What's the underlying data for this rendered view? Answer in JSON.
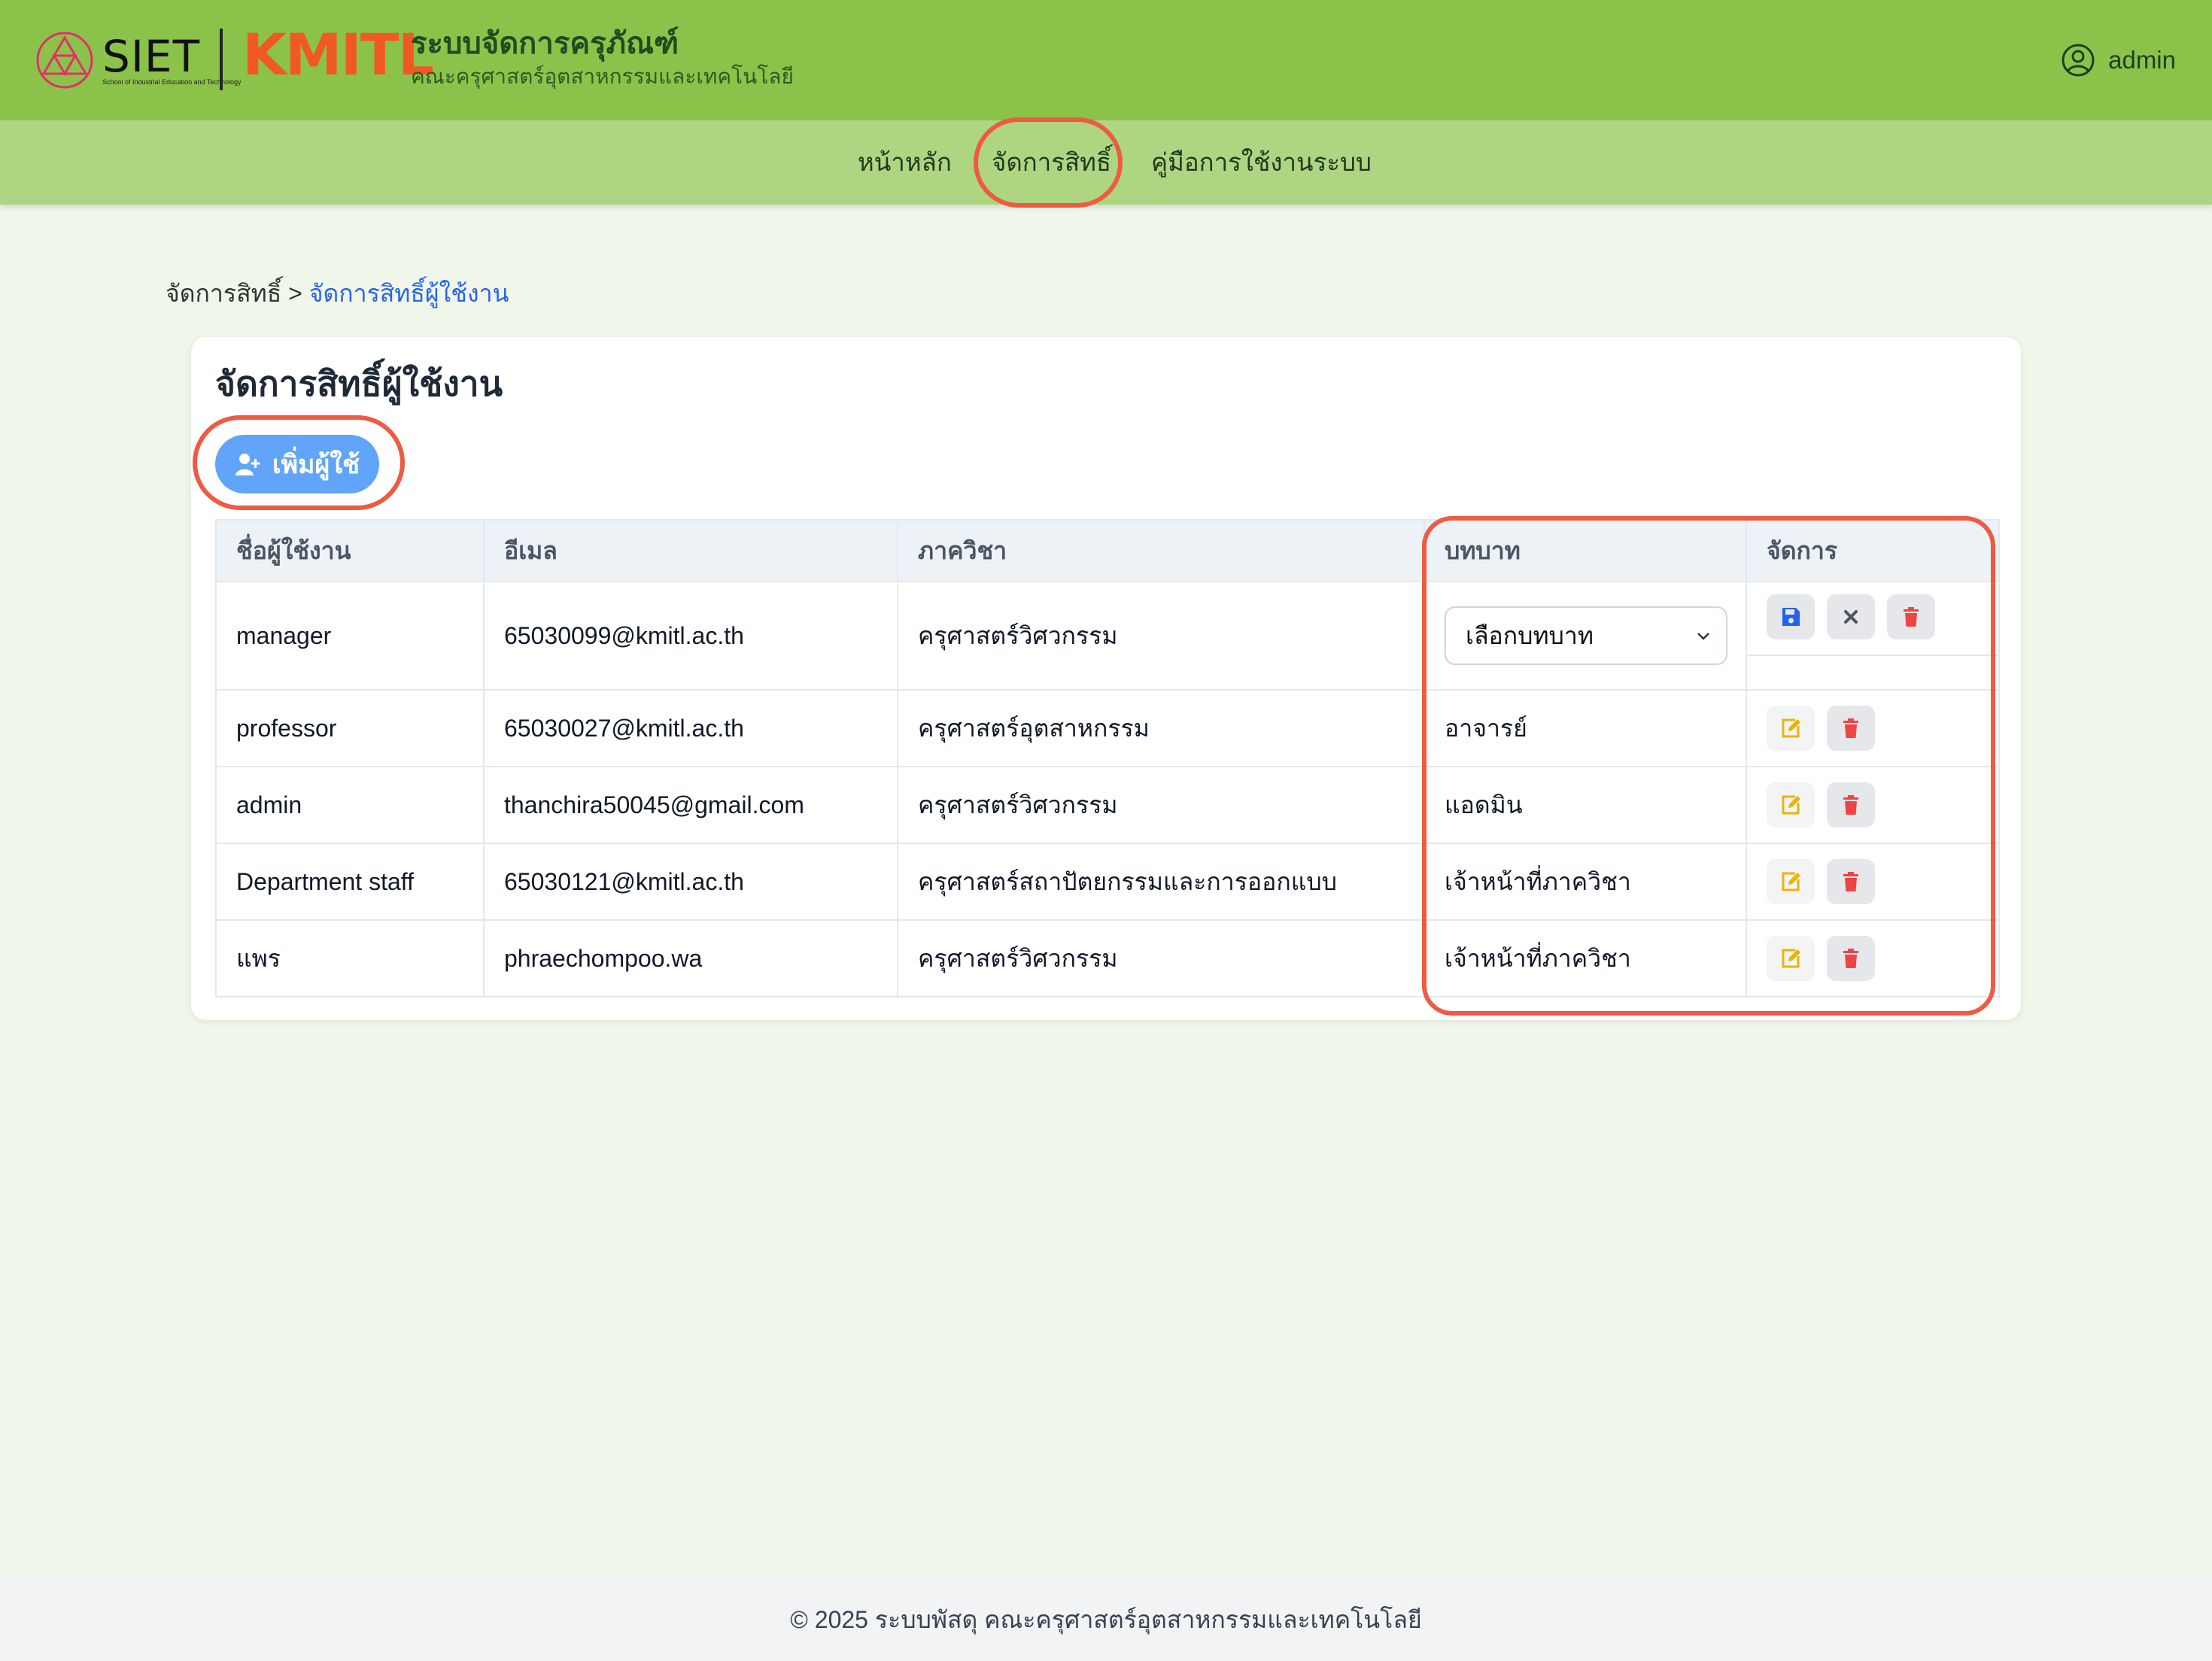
{
  "header": {
    "siet_logo_text": "SIET",
    "siet_logo_sub": "School of Industrial Education and Technology",
    "kmitl_logo_text": "KMITL",
    "app_title": "ระบบจัดการครุภัณฑ์",
    "app_subtitle": "คณะครุศาสตร์อุตสาหกรรมและเทคโนโลยี",
    "username": "admin",
    "colors": {
      "header_bg": "#8bc34a",
      "nav_bg": "#aed581",
      "kmitl": "#f05a22"
    }
  },
  "nav": {
    "items": [
      {
        "label": "หน้าหลัก"
      },
      {
        "label": "จัดการสิทธิ์"
      },
      {
        "label": "คู่มือการใช้งานระบบ"
      }
    ],
    "active_index": 1
  },
  "breadcrumb": {
    "parent": "จัดการสิทธิ์",
    "separator": ">",
    "current": "จัดการสิทธิ์ผู้ใช้งาน"
  },
  "page": {
    "title": "จัดการสิทธิ์ผู้ใช้งาน",
    "add_button_label": "เพิ่มผู้ใช้"
  },
  "table": {
    "columns": [
      "ชื่อผู้ใช้งาน",
      "อีเมล",
      "ภาควิชา",
      "บทบาท",
      "จัดการ"
    ],
    "rows": [
      {
        "username": "manager",
        "email": "65030099@kmitl.ac.th",
        "department": "ครุศาสตร์วิศวกรรม",
        "role_select_value": "เลือกบทบาท",
        "editing": true
      },
      {
        "username": "professor",
        "email": "65030027@kmitl.ac.th",
        "department": "ครุศาสตร์อุตสาหกรรม",
        "role": "อาจารย์"
      },
      {
        "username": "admin",
        "email": "thanchira50045@gmail.com",
        "department": "ครุศาสตร์วิศวกรรม",
        "role": "แอดมิน"
      },
      {
        "username": "Department staff",
        "email": "65030121@kmitl.ac.th",
        "department": "ครุศาสตร์สถาปัตยกรรมและการออกแบบ",
        "role": "เจ้าหน้าที่ภาควิชา"
      },
      {
        "username": "แพร",
        "email": "phraechompoo.wa",
        "department": "ครุศาสตร์วิศวกรรม",
        "role": "เจ้าหน้าที่ภาควิชา"
      }
    ],
    "action_icons": {
      "save": "save-icon",
      "cancel": "close-icon",
      "delete": "trash-icon",
      "edit": "edit-icon"
    },
    "colors": {
      "save": "#2563eb",
      "cancel": "#4b5563",
      "delete": "#ef4444",
      "edit": "#eab308"
    }
  },
  "annotations": {
    "highlight_color": "#ef5a43"
  },
  "footer": {
    "text": "© 2025 ระบบพัสดุ คณะครุศาสตร์อุตสาหกรรมและเทคโนโลยี"
  }
}
